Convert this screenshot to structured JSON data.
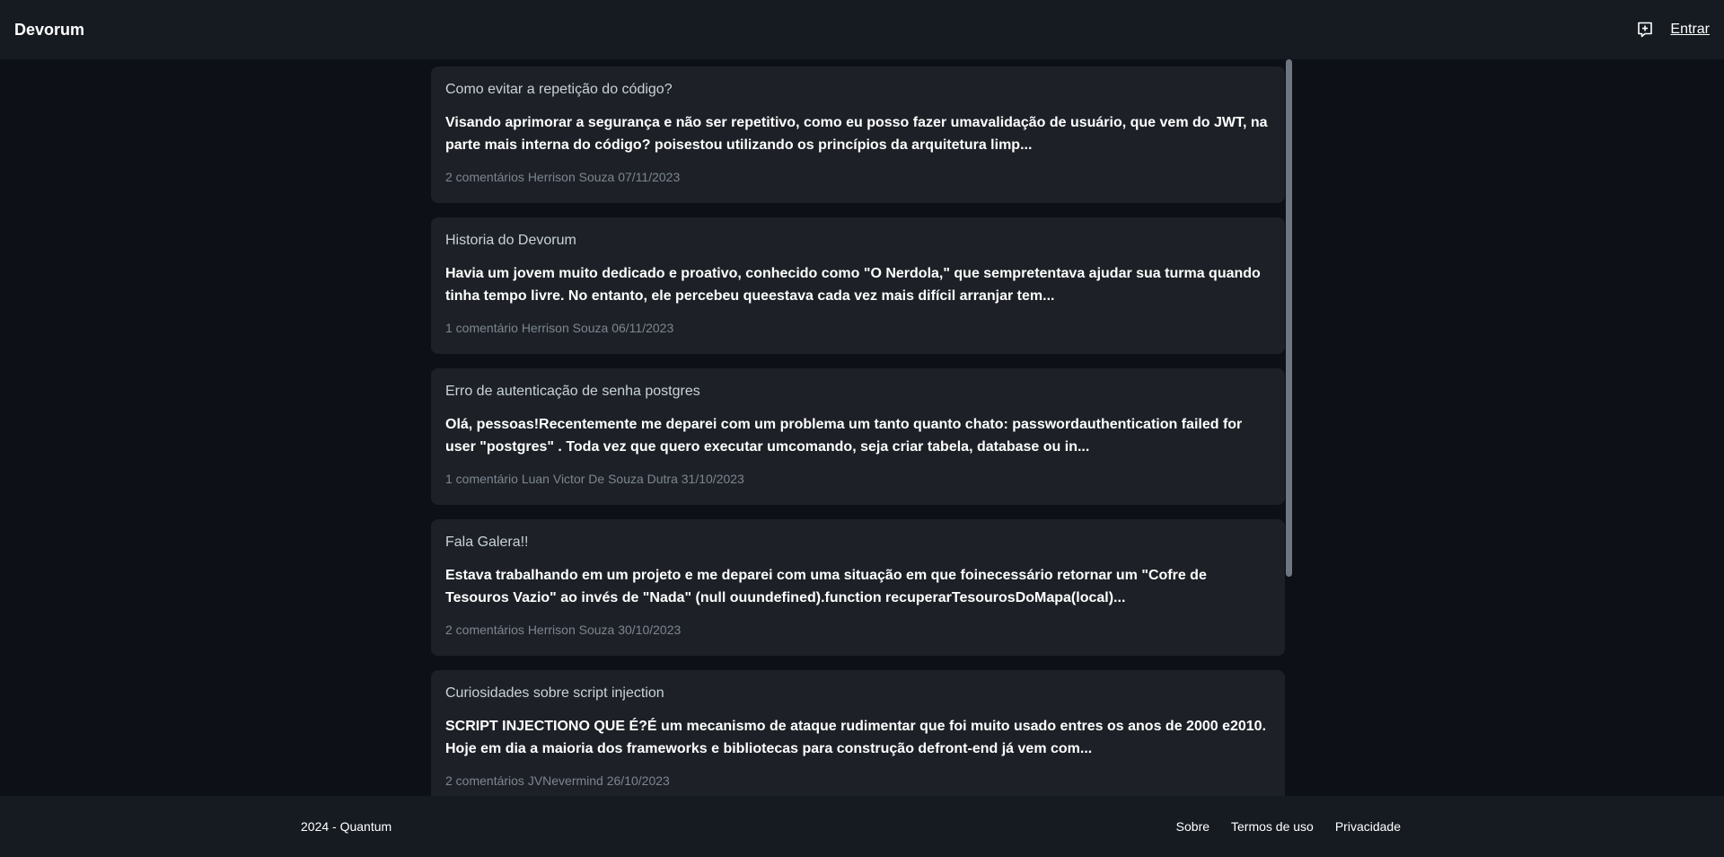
{
  "header": {
    "brand": "Devorum",
    "new_post_icon": "chat-plus-icon",
    "login_label": "Entrar"
  },
  "posts": [
    {
      "title": "Como evitar a repetição do código?",
      "body": "Visando aprimorar a segurança e não ser repetitivo, como eu posso fazer umavalidação de usuário, que vem do JWT, na parte mais interna do código? poisestou utilizando os princípios da arquitetura limp...",
      "meta": "2 comentários Herrison Souza 07/11/2023"
    },
    {
      "title": "Historia do Devorum",
      "body": "Havia um jovem muito dedicado e proativo, conhecido como \"O Nerdola,\" que sempretentava ajudar sua turma quando tinha tempo livre. No entanto, ele percebeu queestava cada vez mais difícil arranjar tem...",
      "meta": "1 comentário Herrison Souza 06/11/2023"
    },
    {
      "title": "Erro de autenticação de senha postgres",
      "body": "Olá, pessoas!Recentemente me deparei com um problema um tanto quanto chato: passwordauthentication failed for user \"postgres\" . Toda vez que quero executar umcomando, seja criar tabela, database ou in...",
      "meta": "1 comentário Luan Victor De Souza Dutra 31/10/2023"
    },
    {
      "title": "Fala Galera!!",
      "body": "Estava trabalhando em um projeto e me deparei com uma situação em que foinecessário retornar um \"Cofre de Tesouros Vazio\" ao invés de \"Nada\" (null ouundefined).function recuperarTesourosDoMapa(local)...",
      "meta": "2 comentários Herrison Souza 30/10/2023"
    },
    {
      "title": "Curiosidades sobre script injection",
      "body": "SCRIPT INJECTIONO QUE É?É um mecanismo de ataque rudimentar que foi muito usado entres os anos de 2000 e2010. Hoje em dia a maioria dos frameworks e bibliotecas para construção defront-end já vem com...",
      "meta": "2 comentários JVNevermind 26/10/2023"
    }
  ],
  "footer": {
    "copyright": "2024 - Quantum",
    "links": [
      "Sobre",
      "Termos de uso",
      "Privacidade"
    ]
  }
}
